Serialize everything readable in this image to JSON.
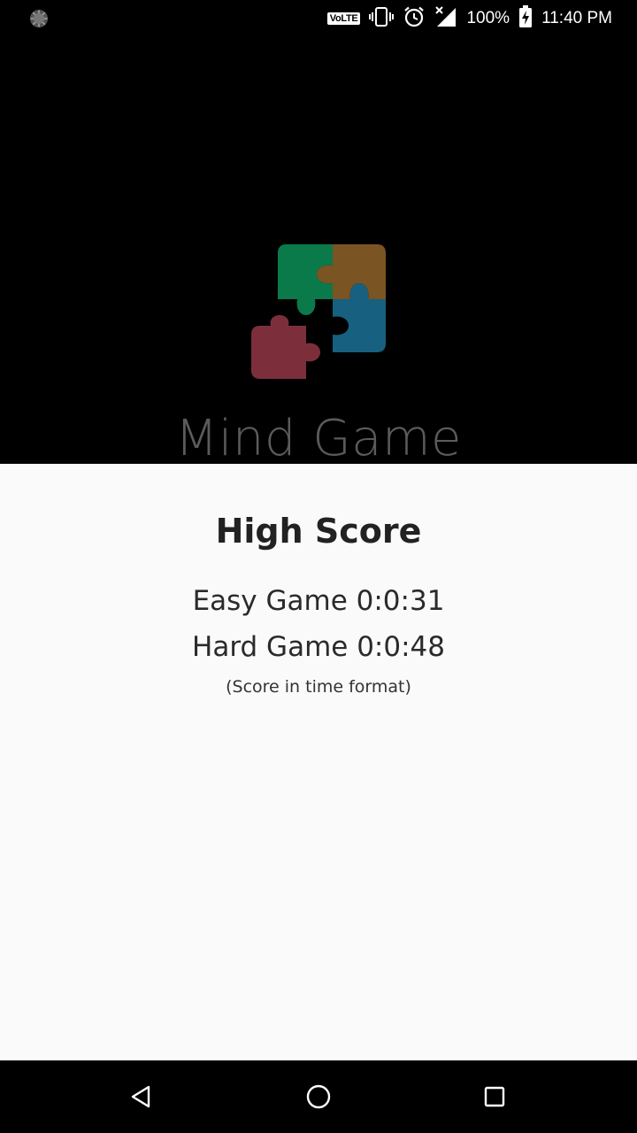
{
  "status_bar": {
    "volte": "VoLTE",
    "battery_percent": "100%",
    "time": "11:40 PM",
    "icons": [
      "loading-icon",
      "vibrate-icon",
      "alarm-icon",
      "signal-icon",
      "battery-charging-icon"
    ]
  },
  "app": {
    "title": "Mind Game",
    "logo_colors": {
      "green": "#0b7a4b",
      "brown": "#7a5423",
      "blue": "#17607f",
      "red": "#7c2f3b"
    }
  },
  "high_score": {
    "heading": "High Score",
    "easy": "Easy Game 0:0:31",
    "hard": "Hard Game 0:0:48",
    "note": "(Score in time format)"
  },
  "nav_bar": {
    "buttons": [
      "back-icon",
      "home-icon",
      "recents-icon"
    ]
  }
}
